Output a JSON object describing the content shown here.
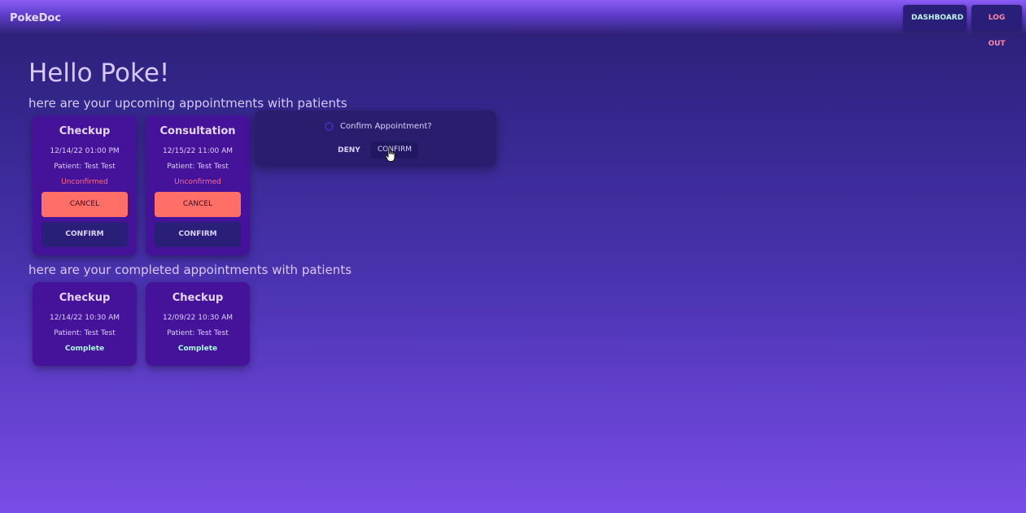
{
  "navbar": {
    "brand": "PokeDoc",
    "dashboard_label": "DASHBOARD",
    "logout_label": "LOG OUT"
  },
  "greeting": "Hello Poke!",
  "upcoming": {
    "title": "here are your upcoming appointments with patients",
    "appointments": [
      {
        "type": "Checkup",
        "datetime": "12/14/22 01:00 PM",
        "patient": "Patient: Test Test",
        "status": "Unconfirmed",
        "cancel_label": "CANCEL",
        "confirm_label": "CONFIRM"
      },
      {
        "type": "Consultation",
        "datetime": "12/15/22 11:00 AM",
        "patient": "Patient: Test Test",
        "status": "Unconfirmed",
        "cancel_label": "CANCEL",
        "confirm_label": "CONFIRM"
      }
    ]
  },
  "completed": {
    "title": "here are your completed appointments with patients",
    "appointments": [
      {
        "type": "Checkup",
        "datetime": "12/14/22 10:30 AM",
        "patient": "Patient: Test Test",
        "status": "Complete"
      },
      {
        "type": "Checkup",
        "datetime": "12/09/22 10:30 AM",
        "patient": "Patient: Test Test",
        "status": "Complete"
      }
    ]
  },
  "popconfirm": {
    "icon": "info-icon",
    "message": "Confirm Appointment?",
    "deny_label": "DENY",
    "confirm_label": "CONFIRM"
  },
  "colors": {
    "accent": "#8b5cf6",
    "card": "#45129a",
    "cancel": "#ff6f68",
    "unconfirmed": "#ff6b86",
    "complete": "#a8ffe9"
  }
}
